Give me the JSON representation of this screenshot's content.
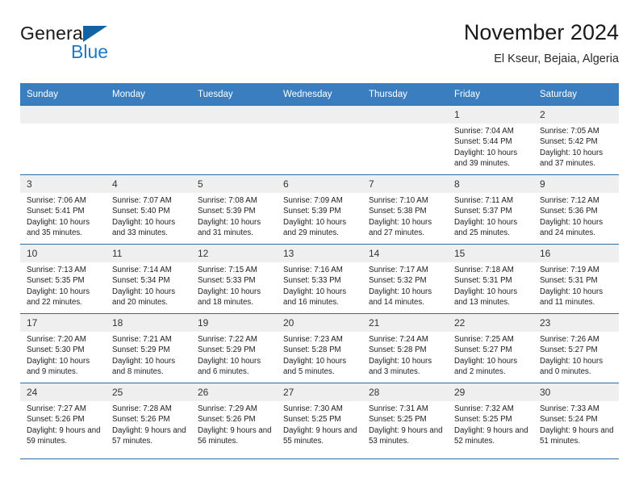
{
  "brand": {
    "name_top": "General",
    "name_bottom": "Blue",
    "triangle_color": "#1263a4",
    "blue_text_color": "#1e7ac4",
    "icon": "general-blue-logo"
  },
  "header": {
    "title": "November 2024",
    "location": "El Kseur, Bejaia, Algeria"
  },
  "theme": {
    "header_row_bg": "#3a7ebf",
    "header_row_text": "#ffffff",
    "daynum_bg": "#efefef",
    "grid_line": "#2e6da4",
    "cell_bg": "#ffffff"
  },
  "weekdays": [
    "Sunday",
    "Monday",
    "Tuesday",
    "Wednesday",
    "Thursday",
    "Friday",
    "Saturday"
  ],
  "labels": {
    "sunrise_prefix": "Sunrise:",
    "sunset_prefix": "Sunset:",
    "daylight_prefix": "Daylight:"
  },
  "weeks": [
    [
      {
        "day": "",
        "empty": true
      },
      {
        "day": "",
        "empty": true
      },
      {
        "day": "",
        "empty": true
      },
      {
        "day": "",
        "empty": true
      },
      {
        "day": "",
        "empty": true
      },
      {
        "day": "1",
        "sunrise": "Sunrise: 7:04 AM",
        "sunset": "Sunset: 5:44 PM",
        "daylight": "Daylight: 10 hours and 39 minutes."
      },
      {
        "day": "2",
        "sunrise": "Sunrise: 7:05 AM",
        "sunset": "Sunset: 5:42 PM",
        "daylight": "Daylight: 10 hours and 37 minutes."
      }
    ],
    [
      {
        "day": "3",
        "sunrise": "Sunrise: 7:06 AM",
        "sunset": "Sunset: 5:41 PM",
        "daylight": "Daylight: 10 hours and 35 minutes."
      },
      {
        "day": "4",
        "sunrise": "Sunrise: 7:07 AM",
        "sunset": "Sunset: 5:40 PM",
        "daylight": "Daylight: 10 hours and 33 minutes."
      },
      {
        "day": "5",
        "sunrise": "Sunrise: 7:08 AM",
        "sunset": "Sunset: 5:39 PM",
        "daylight": "Daylight: 10 hours and 31 minutes."
      },
      {
        "day": "6",
        "sunrise": "Sunrise: 7:09 AM",
        "sunset": "Sunset: 5:39 PM",
        "daylight": "Daylight: 10 hours and 29 minutes."
      },
      {
        "day": "7",
        "sunrise": "Sunrise: 7:10 AM",
        "sunset": "Sunset: 5:38 PM",
        "daylight": "Daylight: 10 hours and 27 minutes."
      },
      {
        "day": "8",
        "sunrise": "Sunrise: 7:11 AM",
        "sunset": "Sunset: 5:37 PM",
        "daylight": "Daylight: 10 hours and 25 minutes."
      },
      {
        "day": "9",
        "sunrise": "Sunrise: 7:12 AM",
        "sunset": "Sunset: 5:36 PM",
        "daylight": "Daylight: 10 hours and 24 minutes."
      }
    ],
    [
      {
        "day": "10",
        "sunrise": "Sunrise: 7:13 AM",
        "sunset": "Sunset: 5:35 PM",
        "daylight": "Daylight: 10 hours and 22 minutes."
      },
      {
        "day": "11",
        "sunrise": "Sunrise: 7:14 AM",
        "sunset": "Sunset: 5:34 PM",
        "daylight": "Daylight: 10 hours and 20 minutes."
      },
      {
        "day": "12",
        "sunrise": "Sunrise: 7:15 AM",
        "sunset": "Sunset: 5:33 PM",
        "daylight": "Daylight: 10 hours and 18 minutes."
      },
      {
        "day": "13",
        "sunrise": "Sunrise: 7:16 AM",
        "sunset": "Sunset: 5:33 PM",
        "daylight": "Daylight: 10 hours and 16 minutes."
      },
      {
        "day": "14",
        "sunrise": "Sunrise: 7:17 AM",
        "sunset": "Sunset: 5:32 PM",
        "daylight": "Daylight: 10 hours and 14 minutes."
      },
      {
        "day": "15",
        "sunrise": "Sunrise: 7:18 AM",
        "sunset": "Sunset: 5:31 PM",
        "daylight": "Daylight: 10 hours and 13 minutes."
      },
      {
        "day": "16",
        "sunrise": "Sunrise: 7:19 AM",
        "sunset": "Sunset: 5:31 PM",
        "daylight": "Daylight: 10 hours and 11 minutes."
      }
    ],
    [
      {
        "day": "17",
        "sunrise": "Sunrise: 7:20 AM",
        "sunset": "Sunset: 5:30 PM",
        "daylight": "Daylight: 10 hours and 9 minutes."
      },
      {
        "day": "18",
        "sunrise": "Sunrise: 7:21 AM",
        "sunset": "Sunset: 5:29 PM",
        "daylight": "Daylight: 10 hours and 8 minutes."
      },
      {
        "day": "19",
        "sunrise": "Sunrise: 7:22 AM",
        "sunset": "Sunset: 5:29 PM",
        "daylight": "Daylight: 10 hours and 6 minutes."
      },
      {
        "day": "20",
        "sunrise": "Sunrise: 7:23 AM",
        "sunset": "Sunset: 5:28 PM",
        "daylight": "Daylight: 10 hours and 5 minutes."
      },
      {
        "day": "21",
        "sunrise": "Sunrise: 7:24 AM",
        "sunset": "Sunset: 5:28 PM",
        "daylight": "Daylight: 10 hours and 3 minutes."
      },
      {
        "day": "22",
        "sunrise": "Sunrise: 7:25 AM",
        "sunset": "Sunset: 5:27 PM",
        "daylight": "Daylight: 10 hours and 2 minutes."
      },
      {
        "day": "23",
        "sunrise": "Sunrise: 7:26 AM",
        "sunset": "Sunset: 5:27 PM",
        "daylight": "Daylight: 10 hours and 0 minutes."
      }
    ],
    [
      {
        "day": "24",
        "sunrise": "Sunrise: 7:27 AM",
        "sunset": "Sunset: 5:26 PM",
        "daylight": "Daylight: 9 hours and 59 minutes."
      },
      {
        "day": "25",
        "sunrise": "Sunrise: 7:28 AM",
        "sunset": "Sunset: 5:26 PM",
        "daylight": "Daylight: 9 hours and 57 minutes."
      },
      {
        "day": "26",
        "sunrise": "Sunrise: 7:29 AM",
        "sunset": "Sunset: 5:26 PM",
        "daylight": "Daylight: 9 hours and 56 minutes."
      },
      {
        "day": "27",
        "sunrise": "Sunrise: 7:30 AM",
        "sunset": "Sunset: 5:25 PM",
        "daylight": "Daylight: 9 hours and 55 minutes."
      },
      {
        "day": "28",
        "sunrise": "Sunrise: 7:31 AM",
        "sunset": "Sunset: 5:25 PM",
        "daylight": "Daylight: 9 hours and 53 minutes."
      },
      {
        "day": "29",
        "sunrise": "Sunrise: 7:32 AM",
        "sunset": "Sunset: 5:25 PM",
        "daylight": "Daylight: 9 hours and 52 minutes."
      },
      {
        "day": "30",
        "sunrise": "Sunrise: 7:33 AM",
        "sunset": "Sunset: 5:24 PM",
        "daylight": "Daylight: 9 hours and 51 minutes."
      }
    ]
  ]
}
